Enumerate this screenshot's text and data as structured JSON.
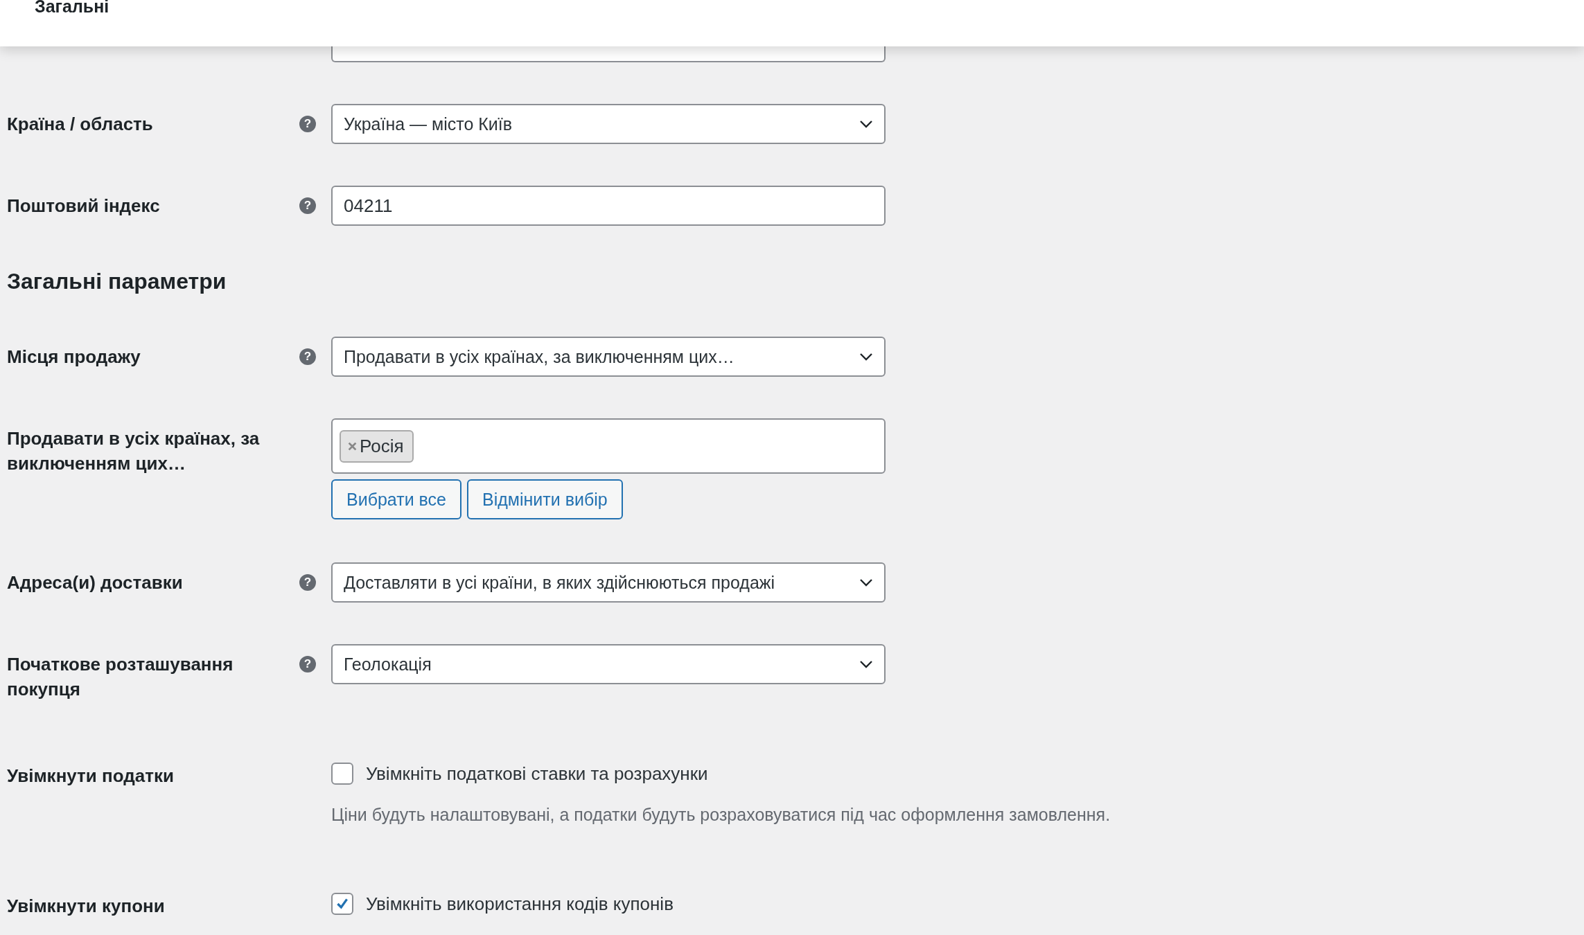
{
  "header": {
    "title": "Загальні"
  },
  "rows": [
    {
      "kind": "select",
      "label": "Країна / область",
      "help": "?",
      "value": "Україна — місто Київ"
    },
    {
      "kind": "text",
      "label": "Поштовий індекс",
      "help": "?",
      "value": "04211"
    },
    {
      "kind": "heading",
      "label": "Загальні параметри"
    },
    {
      "kind": "select",
      "label": "Місця продажу",
      "help": "?",
      "value": "Продавати в усіх країнах, за виключенням цих…"
    },
    {
      "kind": "multiselect",
      "label": "Продавати в усіх країнах, за виключенням цих…",
      "tags": [
        "Росія"
      ],
      "buttons": [
        "Вибрати все",
        "Відмінити вибір"
      ]
    },
    {
      "kind": "select",
      "label": "Адреса(и) доставки",
      "help": "?",
      "value": "Доставляти в усі країни, в яких здійснюються продажі"
    },
    {
      "kind": "select",
      "label": "Початкове розташування покупця",
      "help": "?",
      "value": "Геолокація"
    },
    {
      "kind": "checkbox",
      "label": "Увімкнути податки",
      "checked": false,
      "text": "Увімкніть податкові ставки та розрахунки",
      "description": "Ціни будуть налаштовувані, а податки будуть розраховуватися під час оформлення замовлення."
    },
    {
      "kind": "checkbox",
      "label": "Увімкнути купони",
      "checked": true,
      "text": "Увімкніть використання кодів купонів"
    }
  ]
}
